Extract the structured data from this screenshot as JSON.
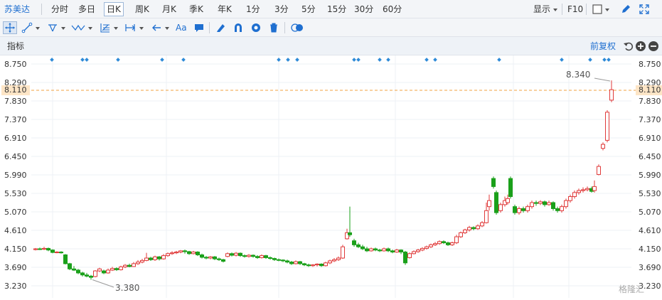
{
  "toolbar": {
    "stock_name": "苏美达",
    "periods": [
      "分时",
      "多日",
      "日K",
      "周K",
      "月K",
      "季K",
      "年K",
      "1分",
      "3分",
      "5分",
      "15分",
      "30分",
      "60分"
    ],
    "active_period": "日K",
    "display_label": "显示",
    "f10_label": "F10"
  },
  "indicator_bar": {
    "label": "指标",
    "adjust_label": "前复权"
  },
  "chart_data": {
    "type": "candlestick",
    "y_axis_ticks": [
      "8.750",
      "8.290",
      "7.830",
      "7.370",
      "6.910",
      "6.450",
      "5.990",
      "5.530",
      "5.070",
      "4.610",
      "4.150",
      "3.690",
      "3.230"
    ],
    "ylim": [
      3.23,
      8.75
    ],
    "current_price": "8.110",
    "high_annotation": "8.340",
    "low_annotation": "3.380",
    "grid": true
  },
  "watermark": "格隆汇"
}
